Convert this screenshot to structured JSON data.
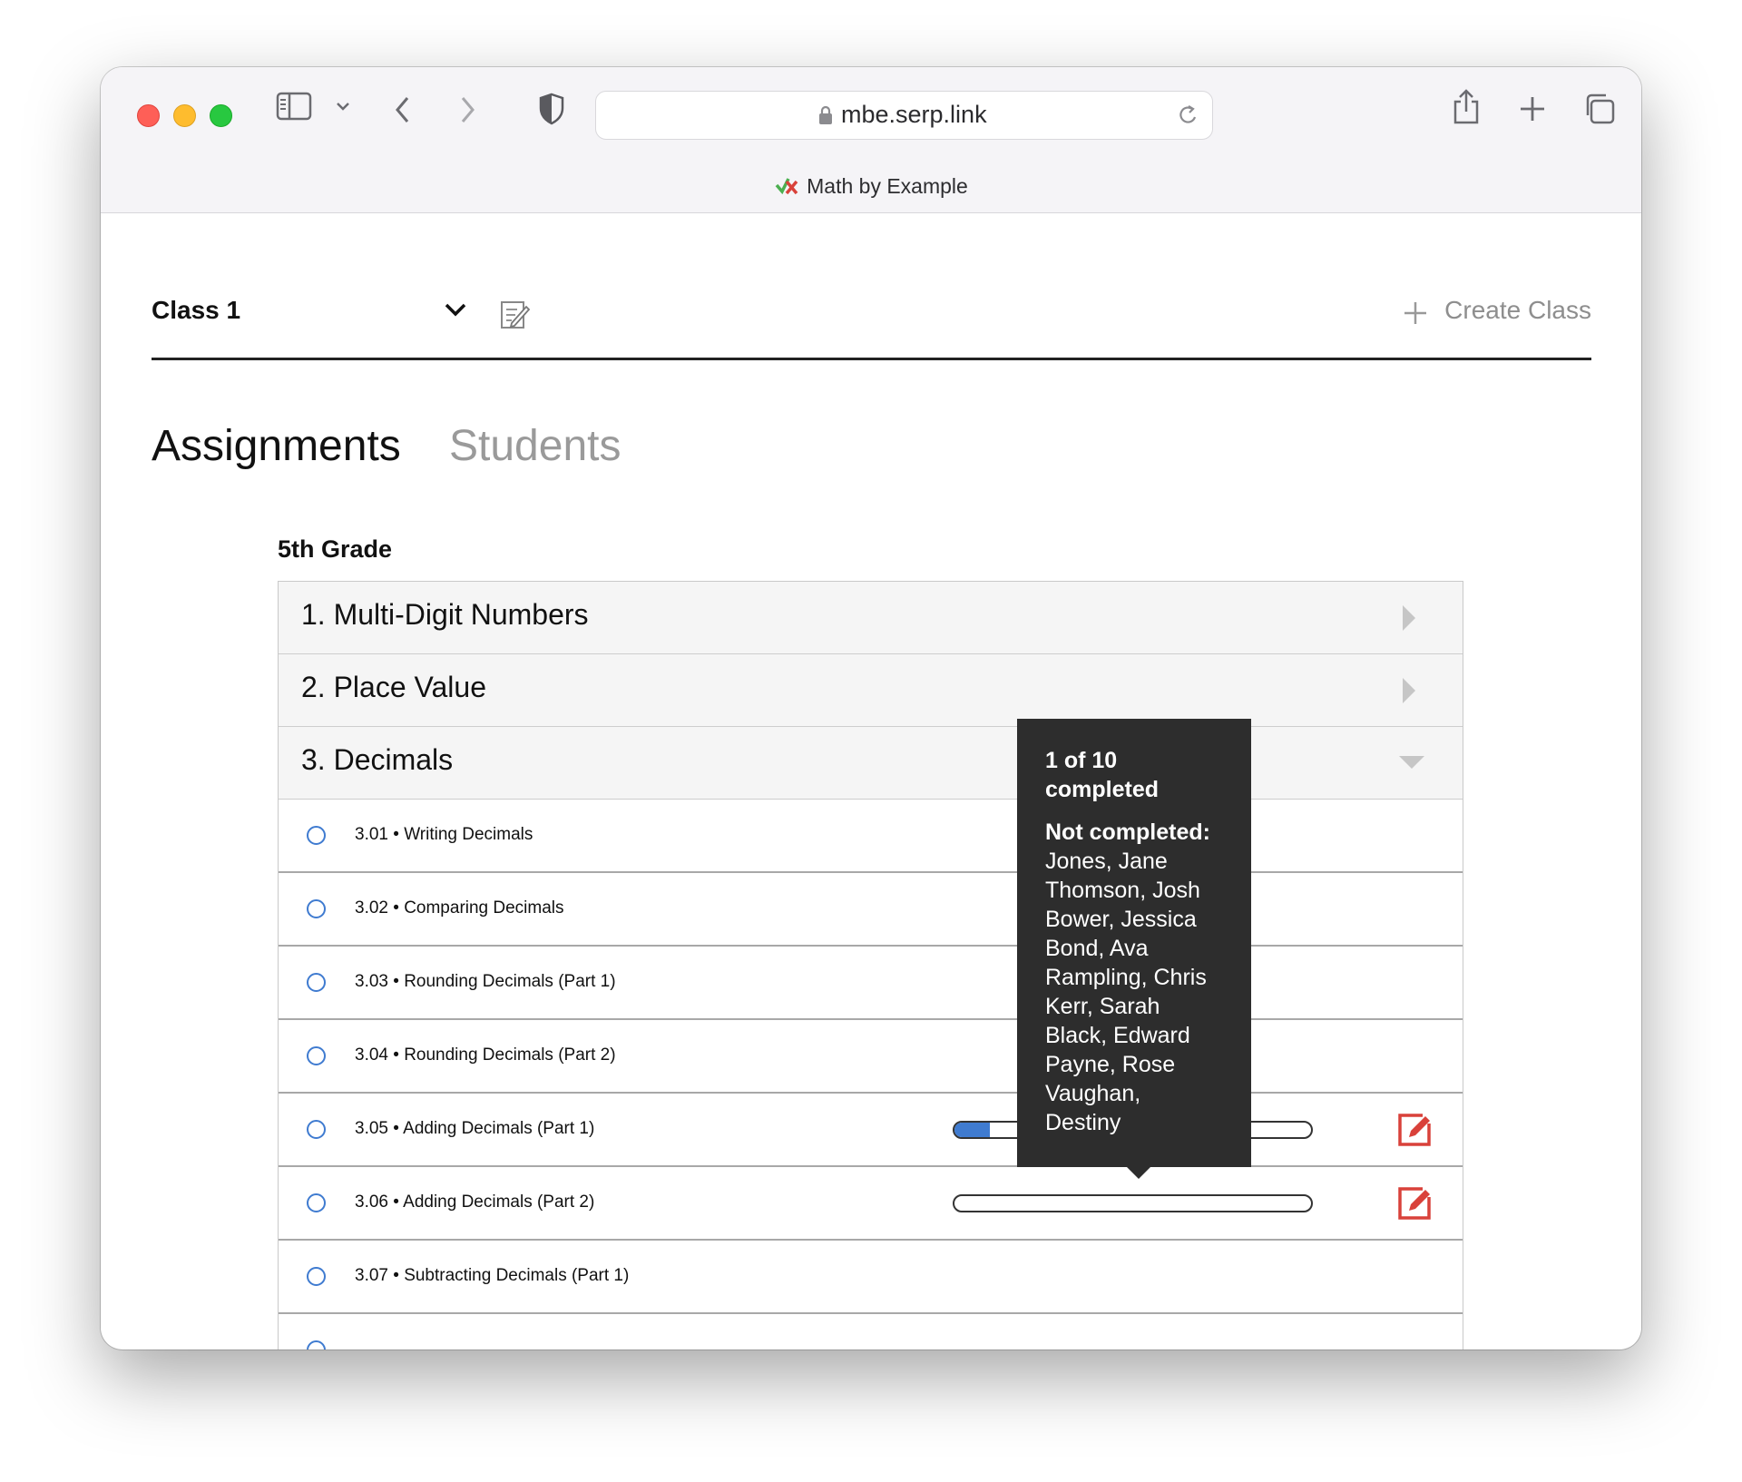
{
  "browser": {
    "url": "mbe.serp.link",
    "tab_title": "Math by Example"
  },
  "header": {
    "class_name": "Class 1",
    "create_class_label": "Create Class"
  },
  "tabs": {
    "assignments": "Assignments",
    "students": "Students"
  },
  "grade": "5th Grade",
  "units": [
    {
      "label": "1. Multi-Digit Numbers",
      "state": "collapsed"
    },
    {
      "label": "2. Place Value",
      "state": "collapsed"
    },
    {
      "label": "3. Decimals",
      "state": "expanded"
    }
  ],
  "lessons": [
    {
      "label": "3.01 • Writing Decimals"
    },
    {
      "label": "3.02 • Comparing Decimals"
    },
    {
      "label": "3.03 • Rounding Decimals (Part 1)"
    },
    {
      "label": "3.04 • Rounding Decimals (Part 2)"
    },
    {
      "label": "3.05 • Adding Decimals (Part 1)",
      "progress": 0.1
    },
    {
      "label": "3.06 • Adding Decimals (Part 2)",
      "progress": 0.0
    },
    {
      "label": "3.07 • Subtracting Decimals (Part 1)"
    }
  ],
  "tooltip": {
    "completed_line1": "1 of 10",
    "completed_line2": "completed",
    "not_completed_label": "Not completed:",
    "names": [
      "Jones, Jane",
      "Thomson, Josh",
      "Bower, Jessica",
      "Bond, Ava",
      "Rampling, Chris",
      "Kerr, Sarah",
      "Black, Edward",
      "Payne, Rose",
      "Vaughan,",
      "Destiny"
    ]
  },
  "colors": {
    "accent_blue": "#3f7bd0",
    "edit_red": "#d9413a",
    "tooltip_bg": "#2d2d2d"
  }
}
